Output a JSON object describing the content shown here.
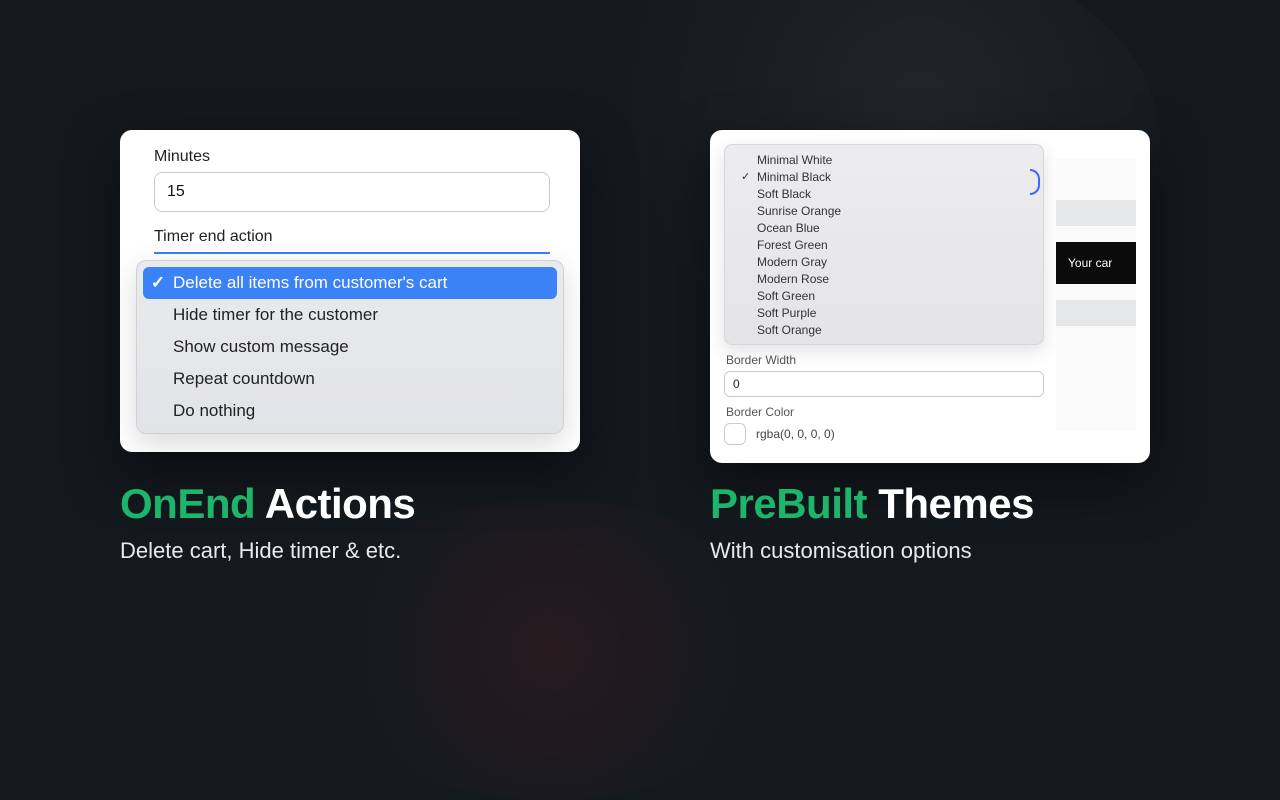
{
  "left_card": {
    "minutes_label": "Minutes",
    "minutes_value": "15",
    "action_label": "Timer end action",
    "options": [
      "Delete all items from customer's cart",
      "Hide timer for the customer",
      "Show custom message",
      "Repeat countdown",
      "Do nothing"
    ],
    "selected_index": 0
  },
  "right_card": {
    "themes": [
      "Minimal White",
      "Minimal Black",
      "Soft Black",
      "Sunrise Orange",
      "Ocean Blue",
      "Forest Green",
      "Modern Gray",
      "Modern Rose",
      "Soft Green",
      "Soft Purple",
      "Soft Orange"
    ],
    "selected_theme_index": 1,
    "border_width_label": "Border Width",
    "border_width_value": "0",
    "border_color_label": "Border Color",
    "border_color_value": "rgba(0, 0, 0, 0)",
    "preview_badge_text": "Your car"
  },
  "captions": {
    "left_accent": "OnEnd",
    "left_rest": " Actions",
    "left_sub": "Delete cart, Hide timer & etc.",
    "right_accent": "PreBuilt",
    "right_rest": " Themes",
    "right_sub": "With customisation options"
  }
}
